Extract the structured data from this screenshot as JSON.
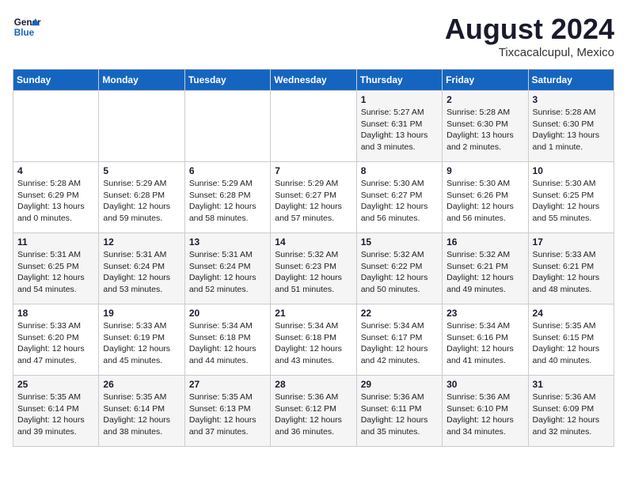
{
  "logo": {
    "line1": "General",
    "line2": "Blue"
  },
  "title": "August 2024",
  "location": "Tixcacalcupul, Mexico",
  "days_of_week": [
    "Sunday",
    "Monday",
    "Tuesday",
    "Wednesday",
    "Thursday",
    "Friday",
    "Saturday"
  ],
  "weeks": [
    [
      {
        "day": "",
        "info": ""
      },
      {
        "day": "",
        "info": ""
      },
      {
        "day": "",
        "info": ""
      },
      {
        "day": "",
        "info": ""
      },
      {
        "day": "1",
        "info": "Sunrise: 5:27 AM\nSunset: 6:31 PM\nDaylight: 13 hours\nand 3 minutes."
      },
      {
        "day": "2",
        "info": "Sunrise: 5:28 AM\nSunset: 6:30 PM\nDaylight: 13 hours\nand 2 minutes."
      },
      {
        "day": "3",
        "info": "Sunrise: 5:28 AM\nSunset: 6:30 PM\nDaylight: 13 hours\nand 1 minute."
      }
    ],
    [
      {
        "day": "4",
        "info": "Sunrise: 5:28 AM\nSunset: 6:29 PM\nDaylight: 13 hours\nand 0 minutes."
      },
      {
        "day": "5",
        "info": "Sunrise: 5:29 AM\nSunset: 6:28 PM\nDaylight: 12 hours\nand 59 minutes."
      },
      {
        "day": "6",
        "info": "Sunrise: 5:29 AM\nSunset: 6:28 PM\nDaylight: 12 hours\nand 58 minutes."
      },
      {
        "day": "7",
        "info": "Sunrise: 5:29 AM\nSunset: 6:27 PM\nDaylight: 12 hours\nand 57 minutes."
      },
      {
        "day": "8",
        "info": "Sunrise: 5:30 AM\nSunset: 6:27 PM\nDaylight: 12 hours\nand 56 minutes."
      },
      {
        "day": "9",
        "info": "Sunrise: 5:30 AM\nSunset: 6:26 PM\nDaylight: 12 hours\nand 56 minutes."
      },
      {
        "day": "10",
        "info": "Sunrise: 5:30 AM\nSunset: 6:25 PM\nDaylight: 12 hours\nand 55 minutes."
      }
    ],
    [
      {
        "day": "11",
        "info": "Sunrise: 5:31 AM\nSunset: 6:25 PM\nDaylight: 12 hours\nand 54 minutes."
      },
      {
        "day": "12",
        "info": "Sunrise: 5:31 AM\nSunset: 6:24 PM\nDaylight: 12 hours\nand 53 minutes."
      },
      {
        "day": "13",
        "info": "Sunrise: 5:31 AM\nSunset: 6:24 PM\nDaylight: 12 hours\nand 52 minutes."
      },
      {
        "day": "14",
        "info": "Sunrise: 5:32 AM\nSunset: 6:23 PM\nDaylight: 12 hours\nand 51 minutes."
      },
      {
        "day": "15",
        "info": "Sunrise: 5:32 AM\nSunset: 6:22 PM\nDaylight: 12 hours\nand 50 minutes."
      },
      {
        "day": "16",
        "info": "Sunrise: 5:32 AM\nSunset: 6:21 PM\nDaylight: 12 hours\nand 49 minutes."
      },
      {
        "day": "17",
        "info": "Sunrise: 5:33 AM\nSunset: 6:21 PM\nDaylight: 12 hours\nand 48 minutes."
      }
    ],
    [
      {
        "day": "18",
        "info": "Sunrise: 5:33 AM\nSunset: 6:20 PM\nDaylight: 12 hours\nand 47 minutes."
      },
      {
        "day": "19",
        "info": "Sunrise: 5:33 AM\nSunset: 6:19 PM\nDaylight: 12 hours\nand 45 minutes."
      },
      {
        "day": "20",
        "info": "Sunrise: 5:34 AM\nSunset: 6:18 PM\nDaylight: 12 hours\nand 44 minutes."
      },
      {
        "day": "21",
        "info": "Sunrise: 5:34 AM\nSunset: 6:18 PM\nDaylight: 12 hours\nand 43 minutes."
      },
      {
        "day": "22",
        "info": "Sunrise: 5:34 AM\nSunset: 6:17 PM\nDaylight: 12 hours\nand 42 minutes."
      },
      {
        "day": "23",
        "info": "Sunrise: 5:34 AM\nSunset: 6:16 PM\nDaylight: 12 hours\nand 41 minutes."
      },
      {
        "day": "24",
        "info": "Sunrise: 5:35 AM\nSunset: 6:15 PM\nDaylight: 12 hours\nand 40 minutes."
      }
    ],
    [
      {
        "day": "25",
        "info": "Sunrise: 5:35 AM\nSunset: 6:14 PM\nDaylight: 12 hours\nand 39 minutes."
      },
      {
        "day": "26",
        "info": "Sunrise: 5:35 AM\nSunset: 6:14 PM\nDaylight: 12 hours\nand 38 minutes."
      },
      {
        "day": "27",
        "info": "Sunrise: 5:35 AM\nSunset: 6:13 PM\nDaylight: 12 hours\nand 37 minutes."
      },
      {
        "day": "28",
        "info": "Sunrise: 5:36 AM\nSunset: 6:12 PM\nDaylight: 12 hours\nand 36 minutes."
      },
      {
        "day": "29",
        "info": "Sunrise: 5:36 AM\nSunset: 6:11 PM\nDaylight: 12 hours\nand 35 minutes."
      },
      {
        "day": "30",
        "info": "Sunrise: 5:36 AM\nSunset: 6:10 PM\nDaylight: 12 hours\nand 34 minutes."
      },
      {
        "day": "31",
        "info": "Sunrise: 5:36 AM\nSunset: 6:09 PM\nDaylight: 12 hours\nand 32 minutes."
      }
    ]
  ]
}
